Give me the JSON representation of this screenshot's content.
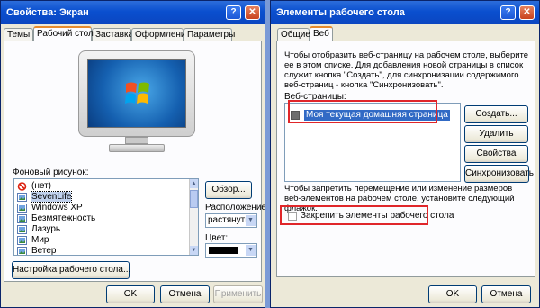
{
  "window1": {
    "title": "Свойства: Экран",
    "help": "?",
    "close": "✕",
    "tabs": [
      "Темы",
      "Рабочий стол",
      "Заставка",
      "Оформление",
      "Параметры"
    ],
    "background_label": "Фоновый рисунок:",
    "backgrounds": [
      {
        "name": "(нет)",
        "icon": "none-icon",
        "selected": false
      },
      {
        "name": "SevenLife",
        "icon": "image-file-icon",
        "selected": true
      },
      {
        "name": "Windows XP",
        "icon": "image-file-icon",
        "selected": false
      },
      {
        "name": "Безмятежность",
        "icon": "image-file-icon",
        "selected": false
      },
      {
        "name": "Лазурь",
        "icon": "image-file-icon",
        "selected": false
      },
      {
        "name": "Мир",
        "icon": "image-file-icon",
        "selected": false
      },
      {
        "name": "Ветер",
        "icon": "image-file-icon",
        "selected": false
      }
    ],
    "browse_button": "Обзор...",
    "position_label": "Расположение:",
    "position_value": "растянуть",
    "color_label": "Цвет:",
    "color_value": "#000000",
    "customize_button": "Настройка рабочего стола...",
    "ok": "OK",
    "cancel": "Отмена",
    "apply": "Применить"
  },
  "window2": {
    "title": "Элементы рабочего стола",
    "help": "?",
    "close": "✕",
    "tabs": [
      "Общие",
      "Веб"
    ],
    "description": "Чтобы отобразить веб-страницу на рабочем столе, выберите ее в этом списке. Для добавления новой страницы в список служит кнопка \"Создать\", для синхронизации содержимого веб-страниц - кнопка \"Синхронизовать\".",
    "webpages_label": "Веб-страницы:",
    "webpages": [
      {
        "name": "Моя текущая домашняя страница",
        "checked": false
      }
    ],
    "create_button": "Создать...",
    "delete_button": "Удалить",
    "properties_button": "Свойства",
    "sync_button": "Синхронизовать",
    "lock_description": "Чтобы запретить перемещение или изменение размеров веб-элементов на рабочем столе, установите следующий флажок.",
    "lock_checkbox": "Закрепить элементы рабочего стола",
    "ok": "OK",
    "cancel": "Отмена",
    "highlight_color": "#e0262a"
  }
}
